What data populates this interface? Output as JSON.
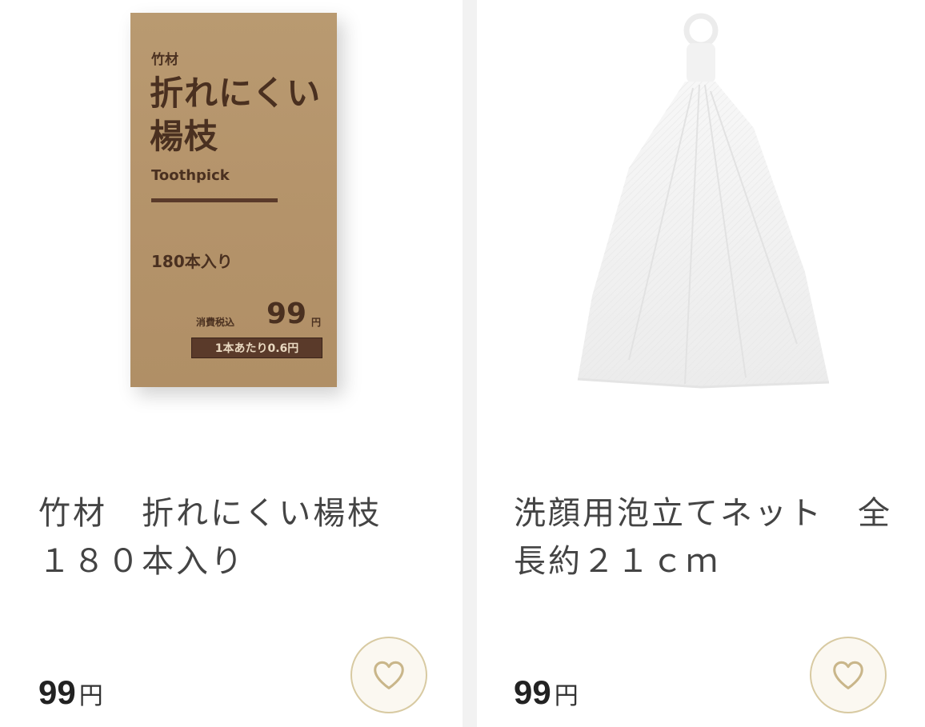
{
  "products": [
    {
      "image": {
        "box_label_small": "竹材",
        "box_title": "折れにくい楊枝",
        "box_en": "Toothpick",
        "box_count": "180本入り",
        "box_tax_label": "消費税込",
        "box_price": "99",
        "box_yen": "円",
        "box_unit_price": "1本あたり0.6円"
      },
      "title": "竹材　折れにくい楊枝\n１８０本入り",
      "price": "99",
      "currency": "円",
      "favorite_icon": "heart-outline-icon"
    },
    {
      "image": {},
      "title": "洗顔用泡立てネット　全長約２１ｃｍ",
      "price": "99",
      "currency": "円",
      "favorite_icon": "heart-outline-icon"
    }
  ],
  "colors": {
    "favorite_border": "#d8caa2",
    "favorite_bg": "#fbf8f1",
    "box_kraft": "#b5946b",
    "box_ink": "#4a3020"
  }
}
